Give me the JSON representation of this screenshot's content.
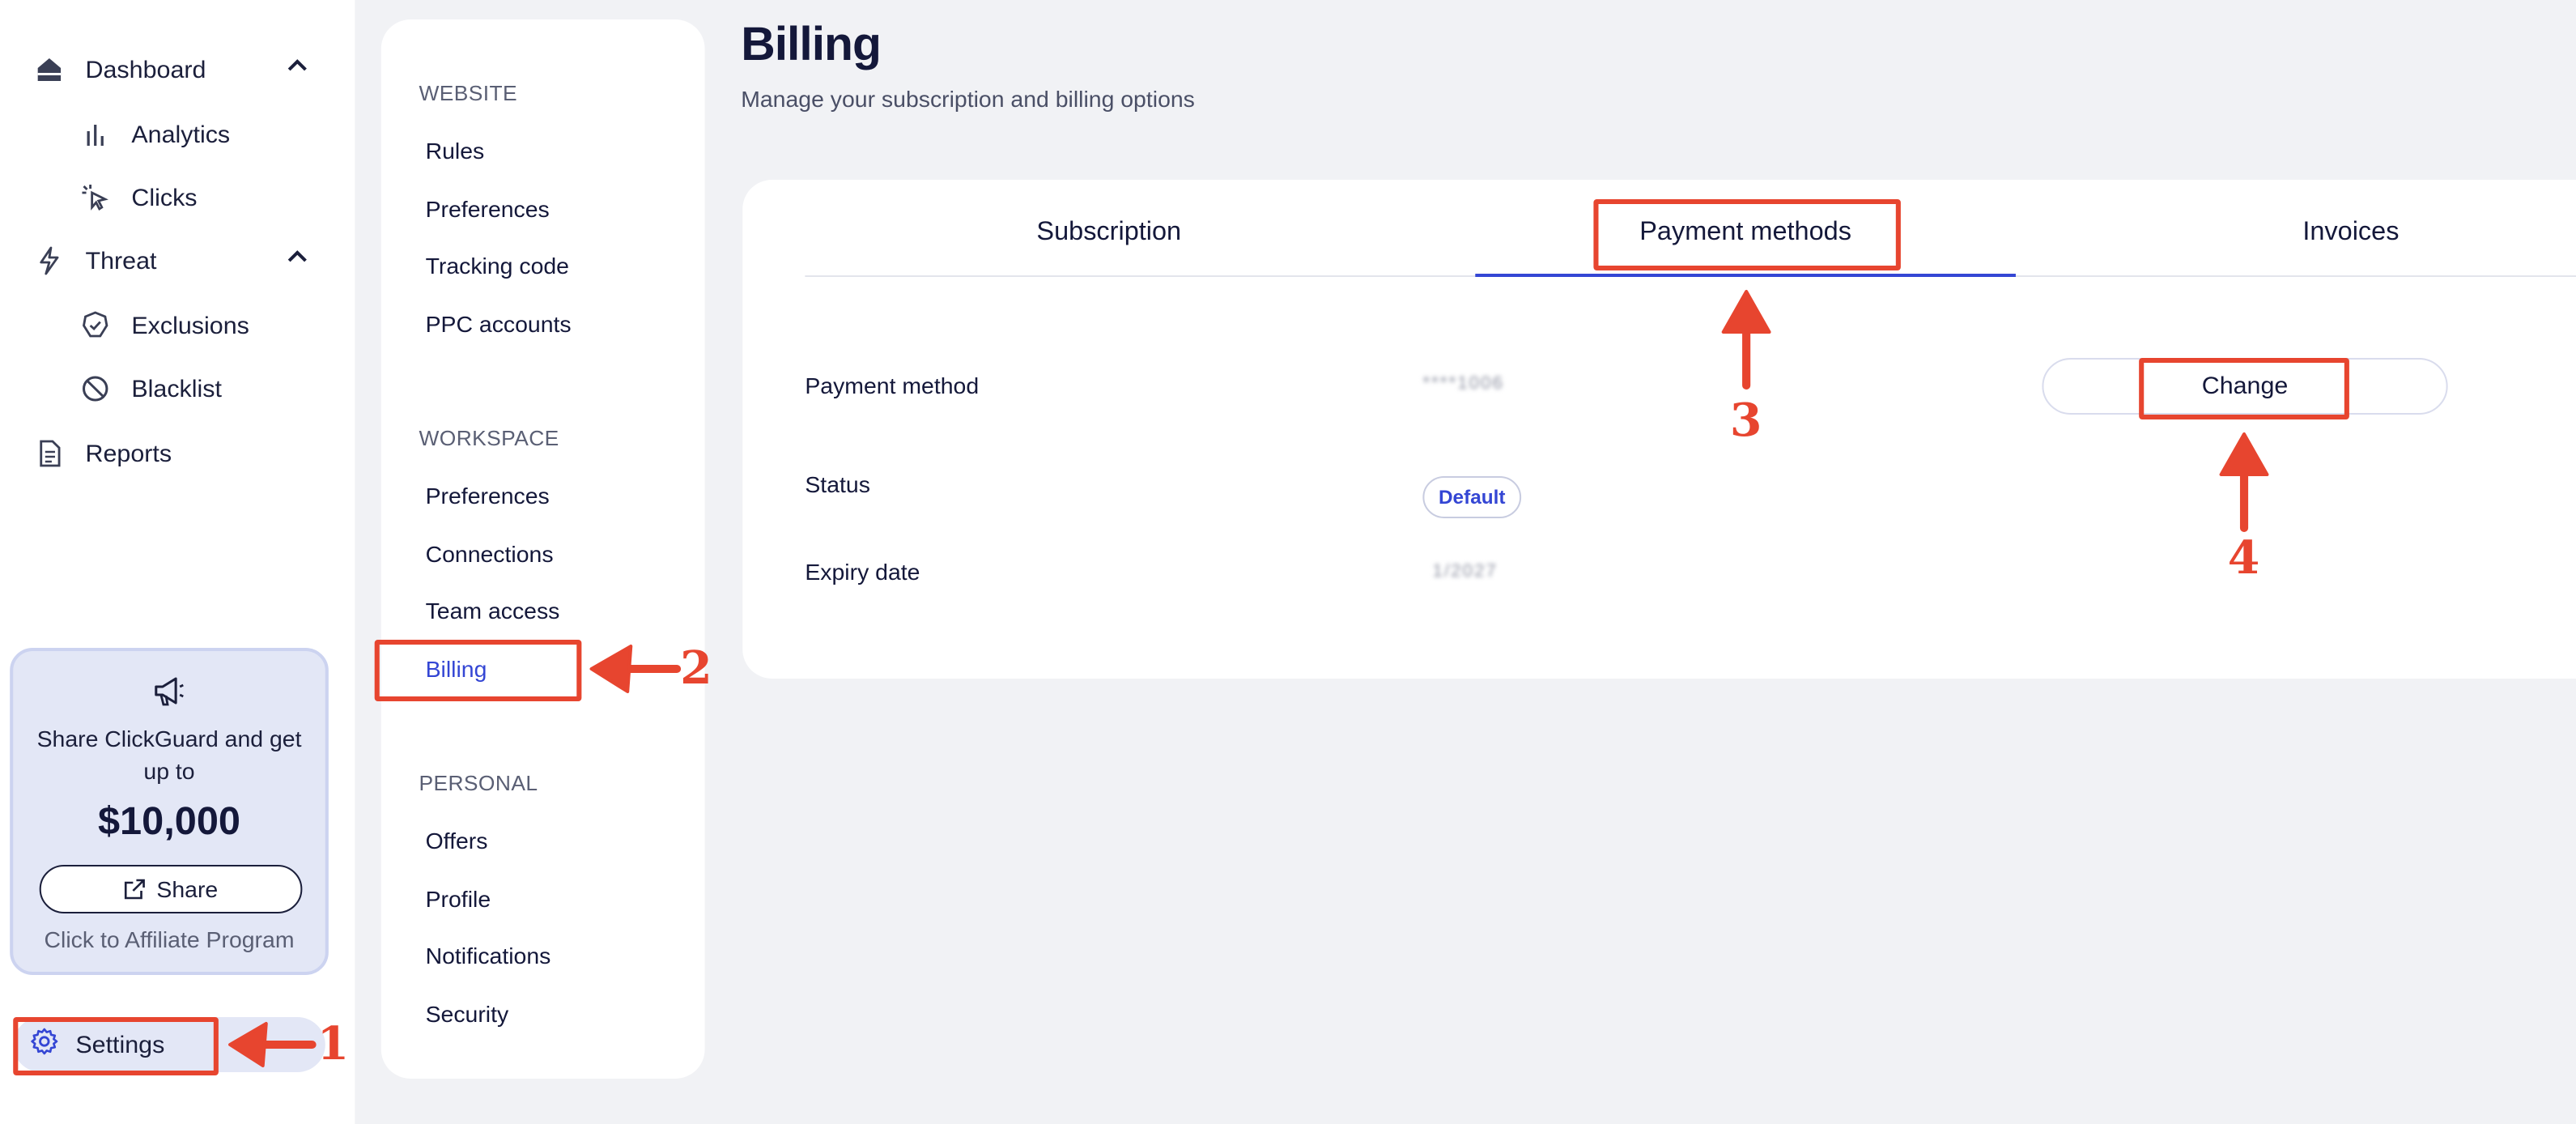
{
  "sidebar": {
    "items": [
      {
        "label": "Dashboard",
        "icon": "home-icon"
      },
      {
        "label": "Analytics",
        "icon": "bar-chart-icon"
      },
      {
        "label": "Clicks",
        "icon": "cursor-click-icon"
      },
      {
        "label": "Threat",
        "icon": "lightning-icon"
      },
      {
        "label": "Exclusions",
        "icon": "shield-check-icon"
      },
      {
        "label": "Blacklist",
        "icon": "ban-icon"
      },
      {
        "label": "Reports",
        "icon": "document-icon"
      }
    ],
    "promo": {
      "text": "Share ClickGuard and get up to",
      "amount": "$10,000",
      "share_label": "Share",
      "affiliate_text": "Click to Affiliate Program"
    },
    "settings_label": "Settings"
  },
  "submenu": {
    "sections": [
      {
        "title": "WEBSITE",
        "items": [
          "Rules",
          "Preferences",
          "Tracking code",
          "PPC accounts"
        ]
      },
      {
        "title": "WORKSPACE",
        "items": [
          "Preferences",
          "Connections",
          "Team access",
          "Billing"
        ]
      },
      {
        "title": "PERSONAL",
        "items": [
          "Offers",
          "Profile",
          "Notifications",
          "Security"
        ]
      }
    ],
    "active_item": "Billing"
  },
  "page": {
    "title": "Billing",
    "subtitle": "Manage your subscription and billing options"
  },
  "billing": {
    "tabs": [
      "Subscription",
      "Payment methods",
      "Invoices"
    ],
    "active_tab": "Payment methods",
    "payment_method_label": "Payment method",
    "payment_method_value": "****1006",
    "status_label": "Status",
    "status_badge": "Default",
    "expiry_label": "Expiry date",
    "expiry_value": "1/2027",
    "change_label": "Change"
  },
  "annotations": {
    "step1": "1",
    "step2": "2",
    "step3": "3",
    "step4": "4",
    "color": "#e7452f"
  },
  "colors": {
    "accent": "#3446d4",
    "background": "#f1f2f5",
    "promo_bg": "#e3e7f6",
    "text": "#14183a"
  }
}
